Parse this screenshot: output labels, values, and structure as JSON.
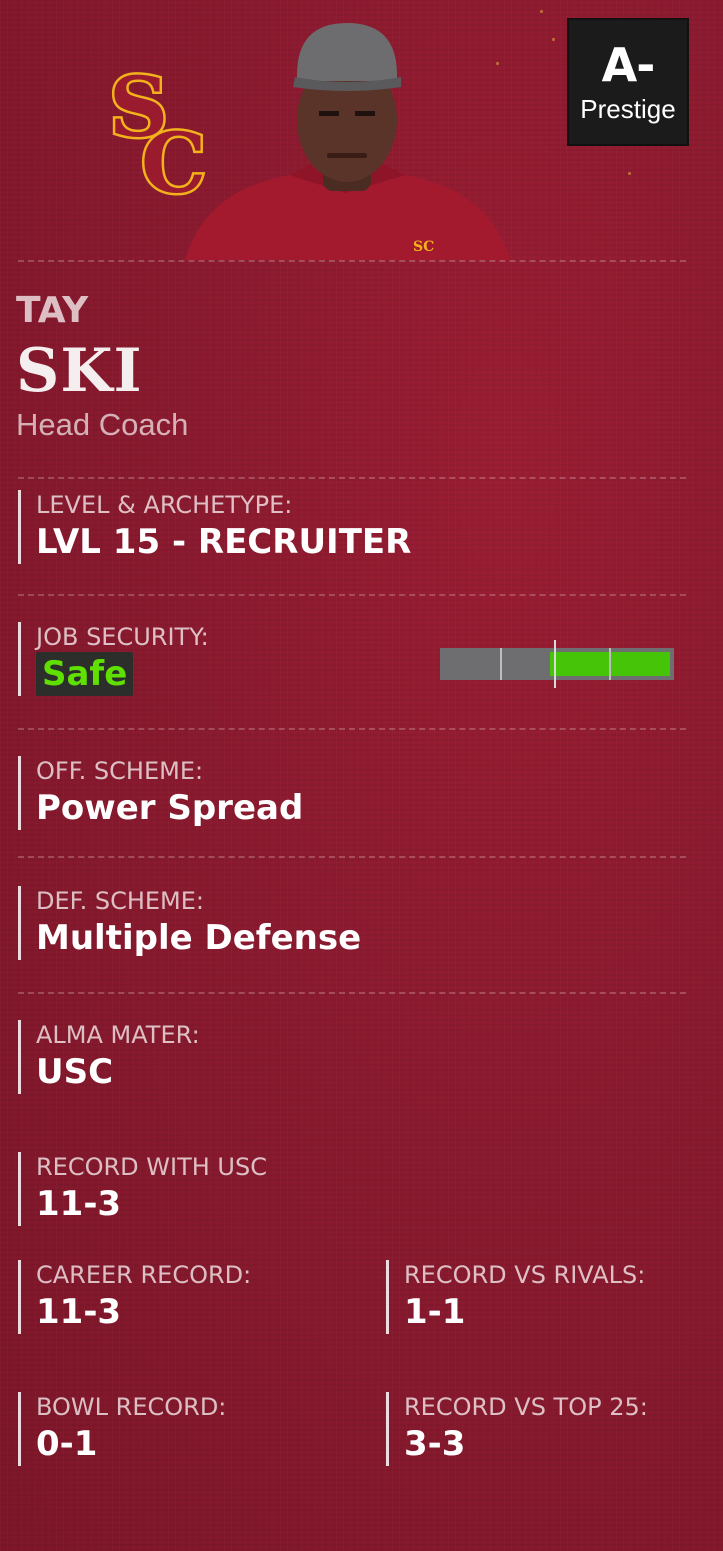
{
  "team": {
    "logo": "usc-sc-logo-icon",
    "primary_color": "#8a1a2f",
    "accent_color": "#f2b21c"
  },
  "prestige": {
    "grade": "A-",
    "label": "Prestige"
  },
  "coach": {
    "first_name": "TAY",
    "last_name": "SKI",
    "role": "Head Coach",
    "portrait": "coach-portrait"
  },
  "fields": {
    "level_archetype": {
      "label": "LEVEL & ARCHETYPE:",
      "value": "LVL 15 - RECRUITER"
    },
    "job_security": {
      "label": "JOB SECURITY:",
      "value": "Safe",
      "meter_level": 0.53,
      "value_color": "#5fe000"
    },
    "off_scheme": {
      "label": "OFF. SCHEME:",
      "value": "Power Spread"
    },
    "def_scheme": {
      "label": "DEF. SCHEME:",
      "value": "Multiple Defense"
    },
    "alma_mater": {
      "label": "ALMA MATER:",
      "value": "USC"
    },
    "record_with_team": {
      "label": "RECORD WITH USC",
      "value": "11-3"
    },
    "career_record": {
      "label": "CAREER RECORD:",
      "value": "11-3"
    },
    "record_vs_rivals": {
      "label": "RECORD VS RIVALS:",
      "value": "1-1"
    },
    "bowl_record": {
      "label": "BOWL RECORD:",
      "value": "0-1"
    },
    "record_vs_top25": {
      "label": "RECORD VS TOP 25:",
      "value": "3-3"
    }
  }
}
